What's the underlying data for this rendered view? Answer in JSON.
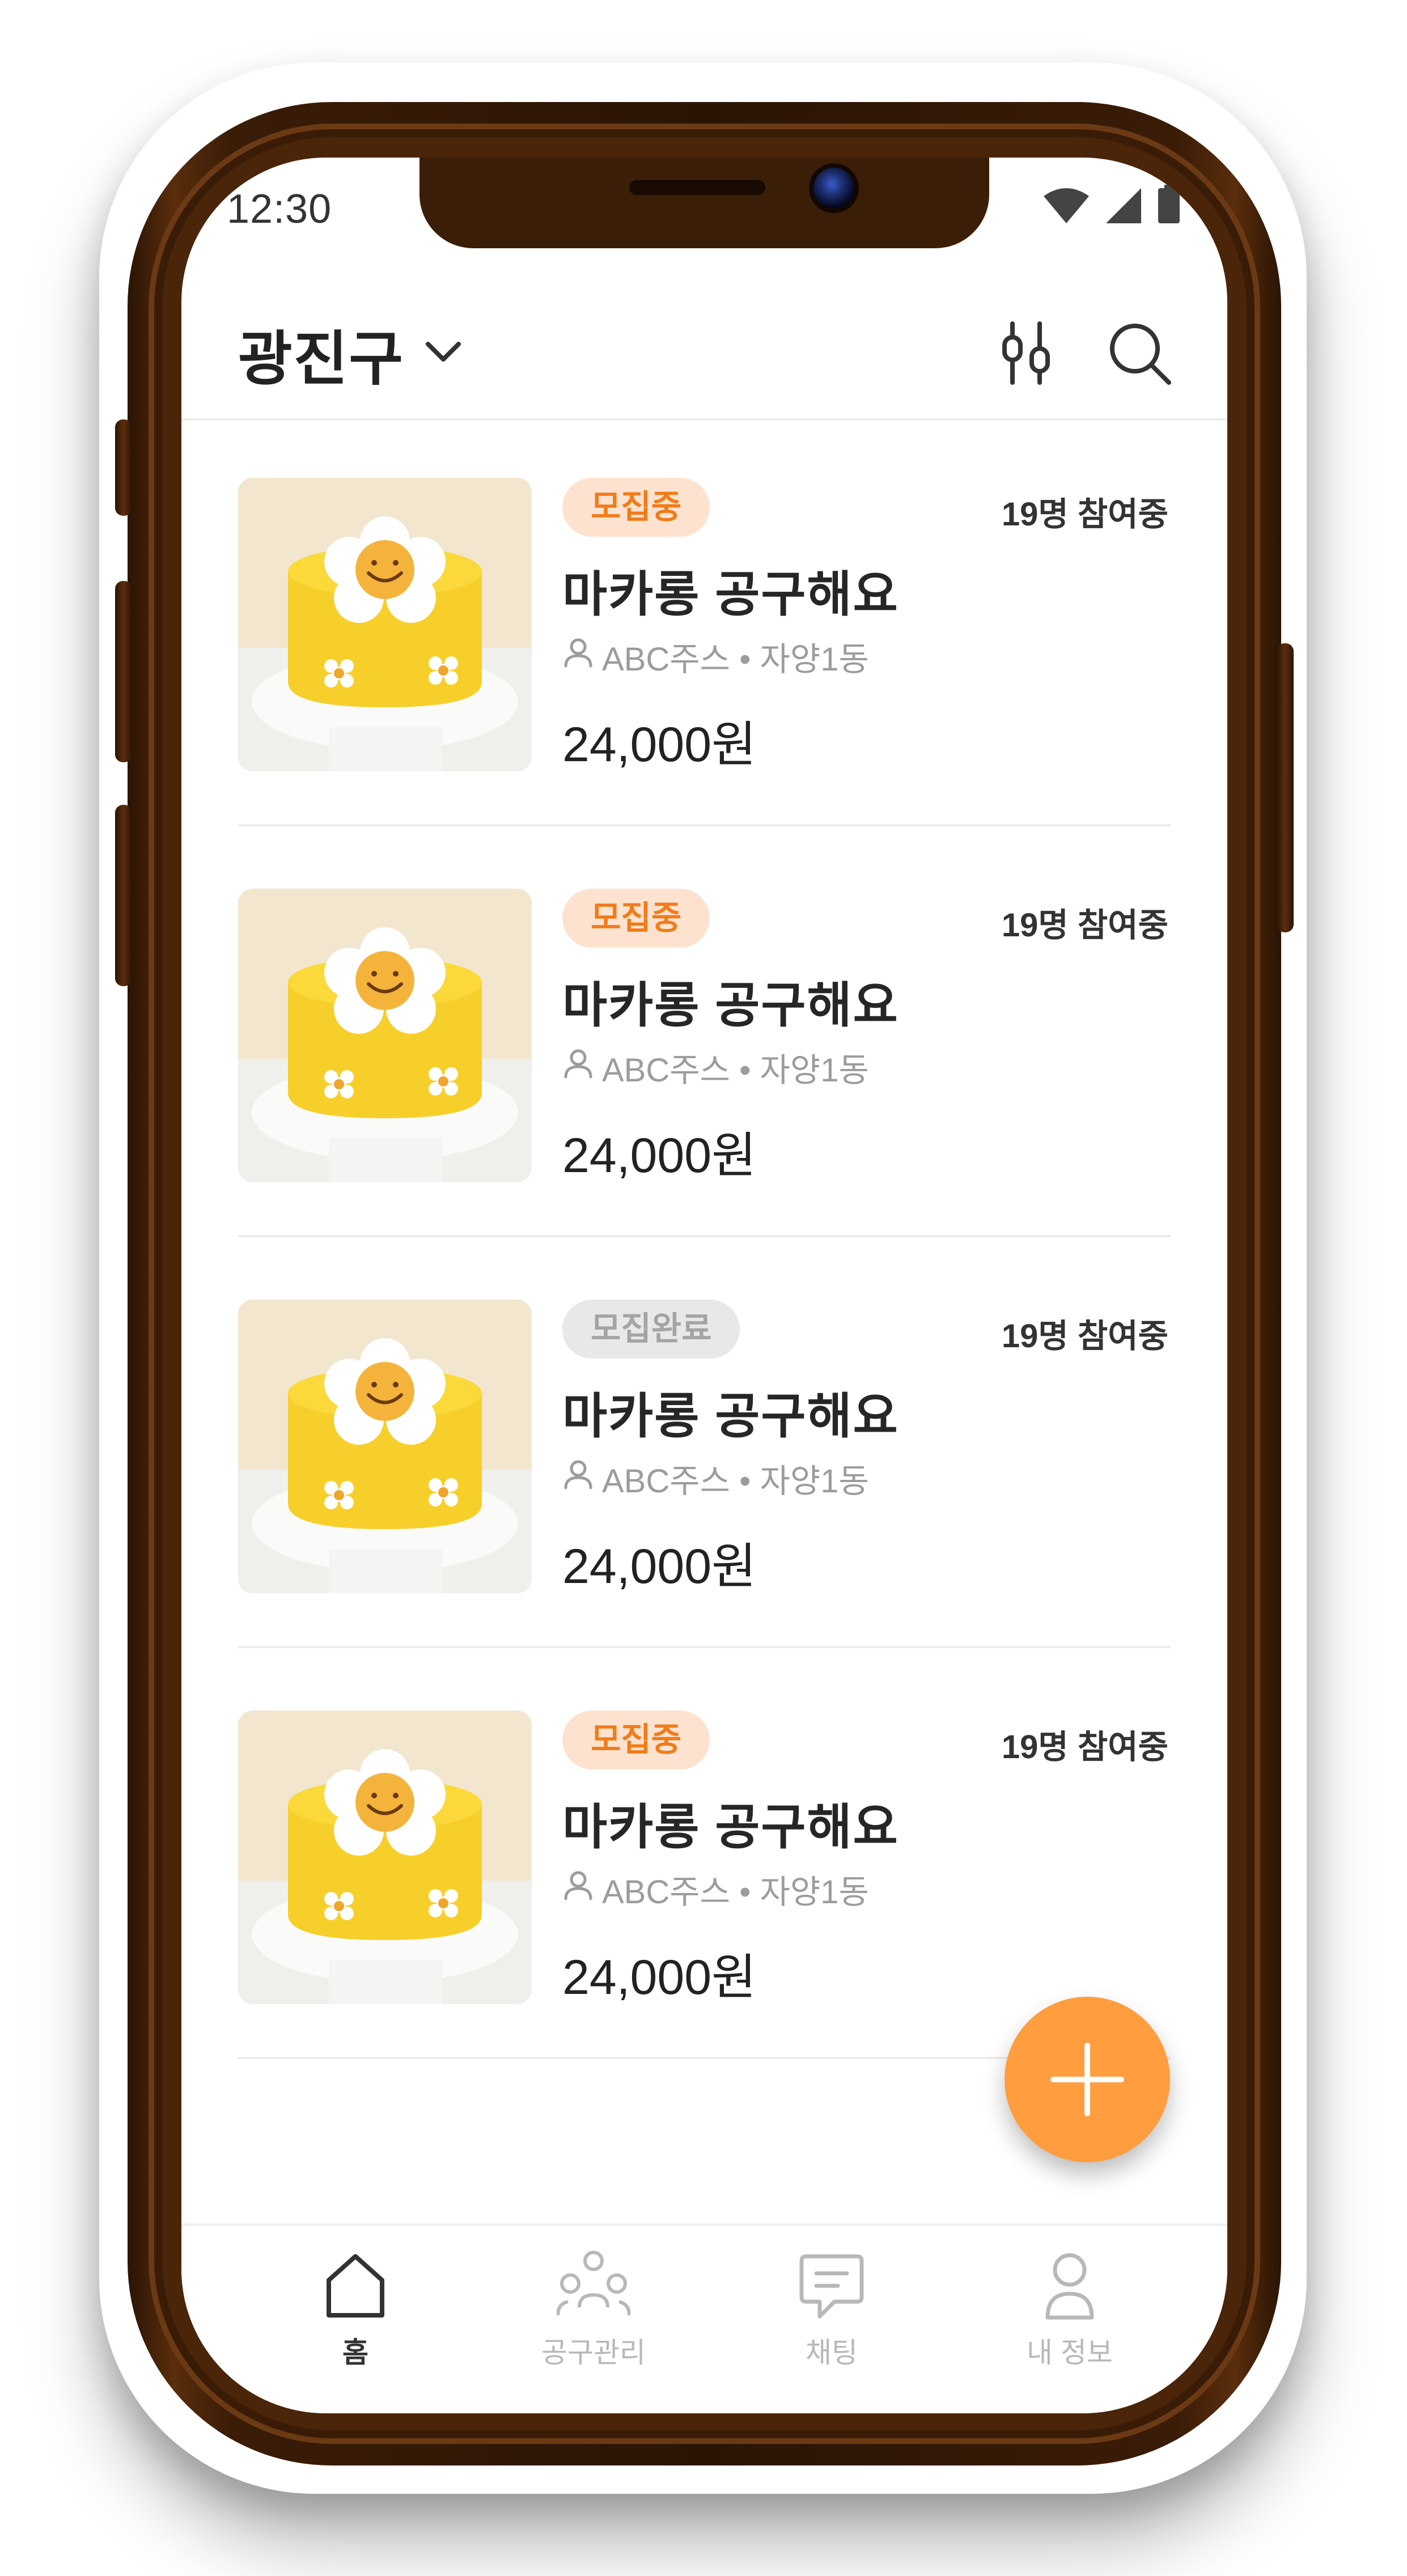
{
  "status_bar": {
    "time": "12:30"
  },
  "header": {
    "location": "광진구"
  },
  "posts": [
    {
      "status": "모집중",
      "status_type": "active",
      "participants": "19명 참여중",
      "title": "마카롱 공구해요",
      "location": "ABC주스 • 자양1동",
      "price": "24,000원"
    },
    {
      "status": "모집중",
      "status_type": "active",
      "participants": "19명 참여중",
      "title": "마카롱 공구해요",
      "location": "ABC주스 • 자양1동",
      "price": "24,000원"
    },
    {
      "status": "모집완료",
      "status_type": "done",
      "participants": "19명 참여중",
      "title": "마카롱 공구해요",
      "location": "ABC주스 • 자양1동",
      "price": "24,000원"
    },
    {
      "status": "모집중",
      "status_type": "active",
      "participants": "19명 참여중",
      "title": "마카롱 공구해요",
      "location": "ABC주스 • 자양1동",
      "price": "24,000원"
    }
  ],
  "nav": [
    {
      "label": "홈",
      "icon": "home-icon",
      "active": true
    },
    {
      "label": "공구관리",
      "icon": "group-icon",
      "active": false
    },
    {
      "label": "채팅",
      "icon": "chat-icon",
      "active": false
    },
    {
      "label": "내 정보",
      "icon": "profile-icon",
      "active": false
    }
  ],
  "colors": {
    "accent": "#ff9d3f",
    "badge_active_bg": "#fde3cf",
    "badge_active_text": "#f07c1a",
    "badge_done_bg": "#e8e8e8",
    "badge_done_text": "#a4a4a4",
    "frame": "#3b1e07"
  }
}
